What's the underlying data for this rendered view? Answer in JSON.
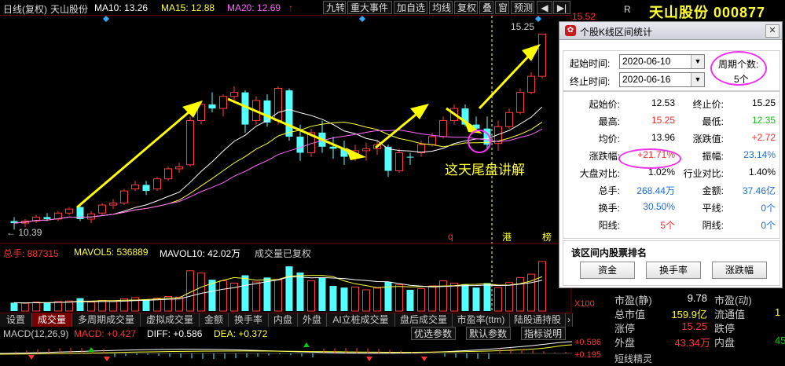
{
  "topbar": {
    "period": "日线(复权)",
    "stock_name": "天山股份",
    "ma10": "MA10: 13.26",
    "ma15": "MA15: 12.88",
    "ma20": "MA20: 12.69",
    "buttons": [
      "九转",
      "重大事件",
      "加自选",
      "均线",
      "复权",
      "叠",
      "窗",
      "预测"
    ]
  },
  "header_right": {
    "r_label": "R",
    "stock_title": "天山股份 000877",
    "price_top": "15.52"
  },
  "chart_labels": {
    "high_label": "15.25",
    "low_label": "← 10.39",
    "annotation": "这天尾盘讲解",
    "marker_q": "q",
    "marker_gang": "港",
    "marker_bang": "榜"
  },
  "volume": {
    "total": "总手: 887315",
    "mavol5": "MAVOL5: 536889",
    "mavol10": "MAVOL10: 42.02万",
    "note": "成交量已复权",
    "x100": "X100"
  },
  "tabs": [
    "设置",
    "成交量",
    "多周期成交量",
    "虚拟成交量",
    "金额",
    "换手率",
    "内盘",
    "外盘",
    "AI立桩成交量",
    "盘后成交量",
    "市盈率(ttm)",
    "陆股通持股"
  ],
  "macd": {
    "label": "MACD(12,26,9)",
    "macd": "MACD: +0.427",
    "diff": "DIFF: +0.586",
    "dea": "DEA: +0.372",
    "btn1": "优选参数",
    "btn2": "默认参数",
    "btn3": "指标说明",
    "axis1": "+0.586",
    "axis2": "+0.195"
  },
  "dialog": {
    "title": "个股K线区间统计",
    "start_label": "起始时间:",
    "start_value": "2020-06-10",
    "end_label": "终止时间:",
    "end_value": "2020-06-16",
    "period_label": "周期个数:",
    "period_value": "5个",
    "rows": [
      {
        "l1": "起始价:",
        "v1": "12.53",
        "c1": "",
        "l2": "终止价:",
        "v2": "15.25",
        "c2": ""
      },
      {
        "l1": "最高:",
        "v1": "15.25",
        "c1": "red",
        "l2": "最低:",
        "v2": "12.35",
        "c2": "green"
      },
      {
        "l1": "均价:",
        "v1": "13.96",
        "c1": "",
        "l2": "涨跌值:",
        "v2": "+2.72",
        "c2": "red"
      },
      {
        "l1": "涨跌幅:",
        "v1": "+21.71%",
        "c1": "red",
        "l2": "振幅:",
        "v2": "23.14%",
        "c2": "blue"
      },
      {
        "l1": "大盘对比:",
        "v1": "1.02%",
        "c1": "",
        "l2": "行业对比:",
        "v2": "1.40%",
        "c2": ""
      },
      {
        "l1": "总手:",
        "v1": "268.44万",
        "c1": "blue",
        "l2": "金额:",
        "v2": "37.46亿",
        "c2": "blue"
      },
      {
        "l1": "换手:",
        "v1": "30.50%",
        "c1": "blue",
        "l2": "平线:",
        "v2": "0个",
        "c2": "blue"
      },
      {
        "l1": "阳线:",
        "v1": "5个",
        "c1": "red",
        "l2": "阴线:",
        "v2": "0个",
        "c2": "blue"
      }
    ],
    "rank_title": "该区间内股票排名",
    "rank_buttons": [
      "资金",
      "换手率",
      "涨跌幅"
    ]
  },
  "right_panel": {
    "rows": [
      {
        "l1": "市盈(静)",
        "v1": "9.78",
        "l2": "市盈(动)",
        "v2": ""
      },
      {
        "l1": "总市值",
        "v1": "159.9亿",
        "l2": "流通值",
        "v2": "1"
      },
      {
        "l1": "涨停",
        "v1": "15.25",
        "l2": "跌停",
        "v2": ""
      },
      {
        "l1": "外盘",
        "v1": "43.34万",
        "l2": "内盘",
        "v2": "45"
      }
    ],
    "bottom_label": "短线精灵"
  },
  "chart_data": {
    "type": "candlestick",
    "dates_note": "",
    "ohlc": [
      [
        10.6,
        10.7,
        10.39,
        10.55
      ],
      [
        10.55,
        10.65,
        10.45,
        10.6
      ],
      [
        10.6,
        10.75,
        10.55,
        10.7
      ],
      [
        10.7,
        10.8,
        10.6,
        10.65
      ],
      [
        10.65,
        10.85,
        10.6,
        10.8
      ],
      [
        10.8,
        10.95,
        10.75,
        10.9
      ],
      [
        10.95,
        11.0,
        10.6,
        10.65
      ],
      [
        10.65,
        10.85,
        10.55,
        10.78
      ],
      [
        10.8,
        11.05,
        10.75,
        11.0
      ],
      [
        11.0,
        11.15,
        10.9,
        11.05
      ],
      [
        11.05,
        11.4,
        11.0,
        11.35
      ],
      [
        11.4,
        11.6,
        11.35,
        11.5
      ],
      [
        11.5,
        11.6,
        11.25,
        11.35
      ],
      [
        11.4,
        11.7,
        11.35,
        11.65
      ],
      [
        11.65,
        11.95,
        11.6,
        11.9
      ],
      [
        11.9,
        12.05,
        11.8,
        11.95
      ],
      [
        12.0,
        13.2,
        11.95,
        13.1
      ],
      [
        13.1,
        13.6,
        13.0,
        13.5
      ],
      [
        13.5,
        13.8,
        13.3,
        13.4
      ],
      [
        13.4,
        13.75,
        13.2,
        13.7
      ],
      [
        13.7,
        13.95,
        13.55,
        13.8
      ],
      [
        13.8,
        13.85,
        12.8,
        13.0
      ],
      [
        13.1,
        13.7,
        13.0,
        13.6
      ],
      [
        13.6,
        13.75,
        12.95,
        13.05
      ],
      [
        13.1,
        13.95,
        13.0,
        13.9
      ],
      [
        13.85,
        13.9,
        12.6,
        12.7
      ],
      [
        12.7,
        13.0,
        12.1,
        12.3
      ],
      [
        12.3,
        12.9,
        12.2,
        12.8
      ],
      [
        12.8,
        13.1,
        12.3,
        12.45
      ],
      [
        12.45,
        12.7,
        12.15,
        12.4
      ],
      [
        12.4,
        12.6,
        12.0,
        12.2
      ],
      [
        12.2,
        12.5,
        12.1,
        12.35
      ],
      [
        12.35,
        12.55,
        12.1,
        12.4
      ],
      [
        12.4,
        12.6,
        12.25,
        12.5
      ],
      [
        12.45,
        12.5,
        11.7,
        11.85
      ],
      [
        11.85,
        12.4,
        11.8,
        12.3
      ],
      [
        12.2,
        12.3,
        12.0,
        12.18
      ],
      [
        12.3,
        12.6,
        12.2,
        12.5
      ],
      [
        12.5,
        12.8,
        12.45,
        12.7
      ],
      [
        12.7,
        13.2,
        12.65,
        13.1
      ],
      [
        13.1,
        13.5,
        13.0,
        13.4
      ],
      [
        13.4,
        13.5,
        12.95,
        13.0
      ],
      [
        13.0,
        13.2,
        12.8,
        12.9
      ],
      [
        12.9,
        13.2,
        12.4,
        12.5
      ],
      [
        12.53,
        13.1,
        12.35,
        12.95
      ],
      [
        12.95,
        13.4,
        12.9,
        13.3
      ],
      [
        13.3,
        13.9,
        13.25,
        13.8
      ],
      [
        13.8,
        14.3,
        13.75,
        14.2
      ],
      [
        14.2,
        15.25,
        14.15,
        15.25
      ]
    ],
    "volume": [
      150000,
      140000,
      160000,
      150000,
      170000,
      180000,
      230000,
      160000,
      190000,
      170000,
      220000,
      240000,
      210000,
      230000,
      260000,
      250000,
      720000,
      680000,
      560000,
      540000,
      500000,
      640000,
      520000,
      600000,
      560000,
      800000,
      690000,
      540000,
      600000,
      450000,
      420000,
      430000,
      380000,
      410000,
      520000,
      470000,
      380000,
      400000,
      450000,
      540000,
      500000,
      480000,
      420000,
      500000,
      420000,
      510000,
      600000,
      660000,
      887315
    ]
  }
}
